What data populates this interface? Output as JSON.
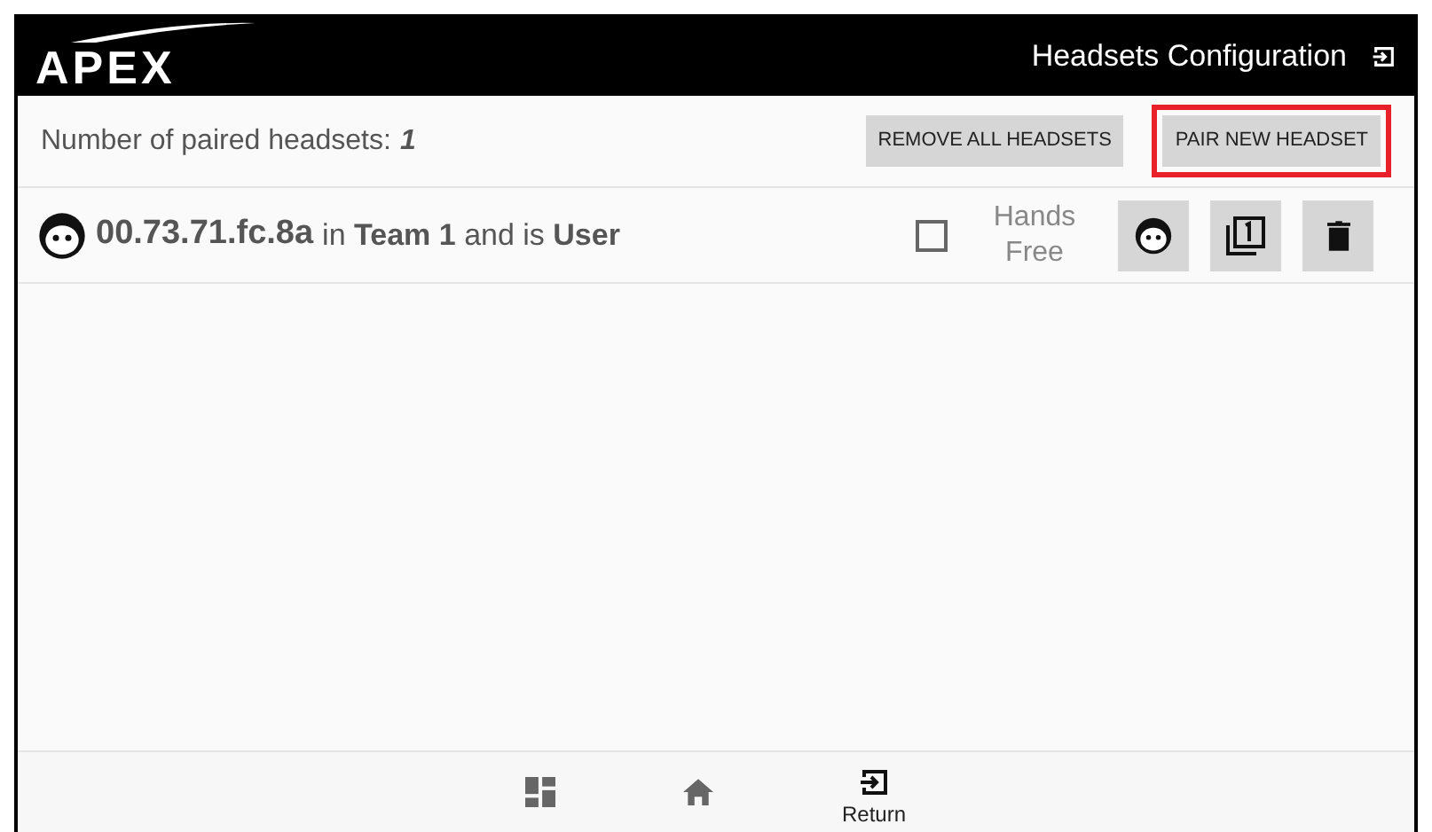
{
  "header": {
    "logo": "APEX",
    "title": "Headsets Configuration"
  },
  "toolbar": {
    "count_label": "Number of paired headsets:",
    "count": "1",
    "buttons": [
      {
        "label": "REMOVE ALL HEADSETS",
        "highlighted": false
      },
      {
        "label": "PAIR NEW HEADSET",
        "highlighted": true
      }
    ]
  },
  "headsets": [
    {
      "address": "00.73.71.fc.8a",
      "details": "in **Team 1** and is **User**",
      "hands_free_label": "Hands Free",
      "hands_free": false
    }
  ],
  "bottom_nav": [
    {
      "kind": "dashboard"
    },
    {
      "kind": "home"
    },
    {
      "kind": "return",
      "label": "Return"
    }
  ]
}
